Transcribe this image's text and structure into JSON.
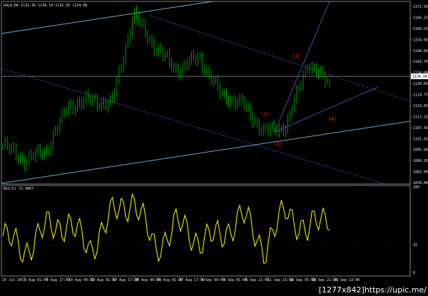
{
  "instrument": {
    "label": "GOLD,H4",
    "quote": "1132.95 1136.14 1132.95 1134.00"
  },
  "indicator": {
    "label": "RSI(5) 72.4067",
    "levels": [
      "100",
      "32",
      "0"
    ]
  },
  "price_axis": {
    "ticks": [
      "1171.95",
      "1166.25",
      "1160.55",
      "1154.85",
      "1148.85",
      "1142.70",
      "1134.00",
      "1130.85",
      "1124.75",
      "1119.05",
      "1113.25",
      "1107.45",
      "1101.65",
      "1095.60",
      "1089.95",
      "1083.90",
      "1078.00"
    ],
    "current_price": "1134.00"
  },
  "time_axis": {
    "ticks": [
      "29 Jul 2015",
      "3 Aug 01:00",
      "5 Aug 17:00",
      "10 Aug 09:00",
      "13 Aug 01:00",
      "17 Aug 17:00",
      "20 Aug 09:00",
      "25 Aug 01:00",
      "27 Aug 17:00",
      "1 Sep 09:00",
      "4 Sep 01:00",
      "8 Sep 21:00",
      "11 Sep 13:00",
      "16 Sep 05:00",
      "18 Sep 21:00",
      "23 Sep 13:00"
    ]
  },
  "wave_labels": [
    "(1)",
    "(2)",
    "(3)",
    "(4)"
  ],
  "colors": {
    "background": "#000000",
    "candles": "#00c000",
    "rsi_line": "#ffff00",
    "channel_line": "#6fa8c8",
    "dotted_channel": "#5050c0",
    "wave_label": "#ff2020"
  },
  "watermark": "[1277x842]https://upic.me/",
  "chart_data": {
    "type": "line",
    "title": "GOLD,H4",
    "x": [
      "29 Jul 2015",
      "3 Aug 01:00",
      "5 Aug 17:00",
      "10 Aug 09:00",
      "13 Aug 01:00",
      "17 Aug 17:00",
      "20 Aug 09:00",
      "25 Aug 01:00",
      "27 Aug 17:00",
      "1 Sep 09:00",
      "4 Sep 01:00",
      "8 Sep 21:00",
      "11 Sep 13:00",
      "16 Sep 05:00",
      "18 Sep 21:00",
      "23 Sep 13:00"
    ],
    "series": [
      {
        "name": "GOLD,H4",
        "values": [
          1098,
          1090,
          1095,
          1119,
          1122,
          1120,
          1168,
          1150,
          1138,
          1145,
          1125,
          1120,
          1105,
          1108,
          1142,
          1130
        ]
      },
      {
        "name": "RSI(5) 72.4067",
        "values": [
          45,
          28,
          55,
          60,
          30,
          70,
          88,
          30,
          60,
          40,
          45,
          70,
          30,
          75,
          50,
          72
        ]
      }
    ],
    "ylim": [
      1078.0,
      1171.95
    ]
  }
}
